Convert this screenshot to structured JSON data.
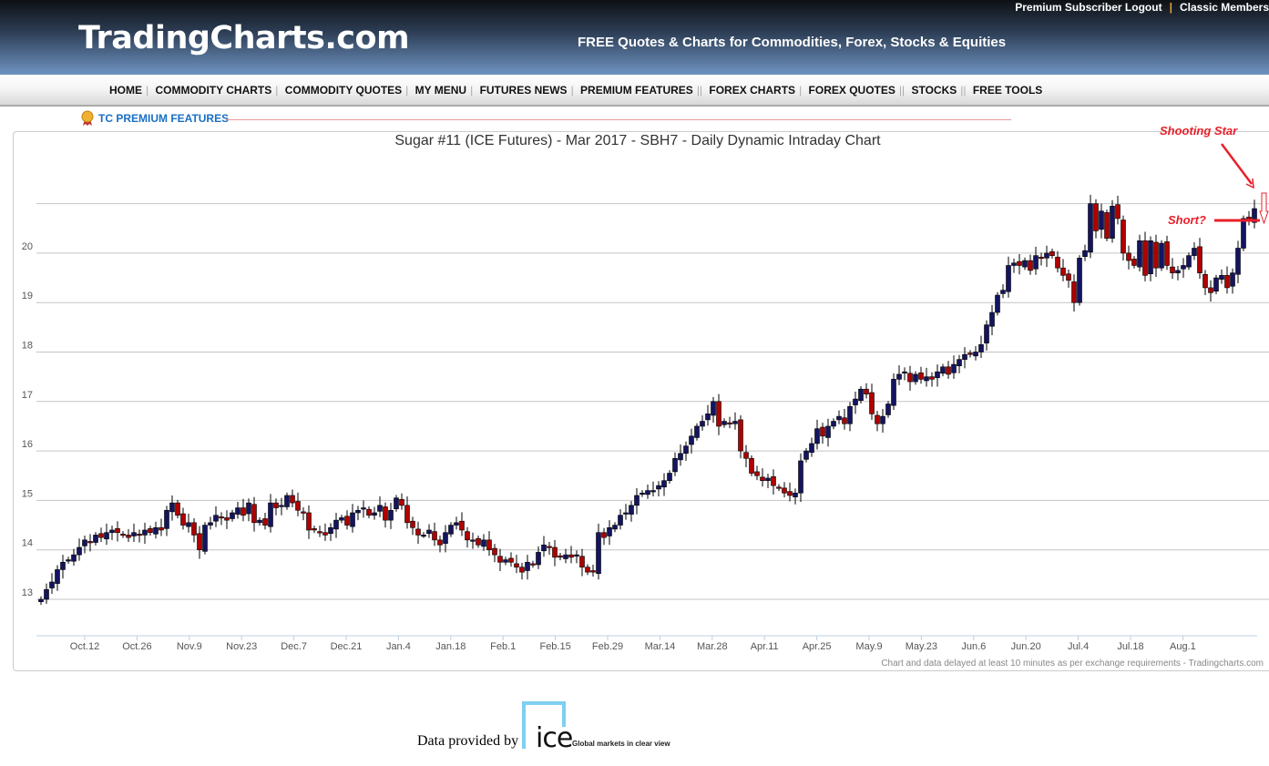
{
  "header": {
    "logo": "TradingCharts.com",
    "tagline": "FREE Quotes & Charts for Commodities, Forex, Stocks & Equities",
    "links": [
      "Premium Subscriber Logout",
      "Classic Members"
    ]
  },
  "nav": [
    "HOME",
    "COMMODITY CHARTS",
    "COMMODITY QUOTES",
    "MY MENU",
    "FUTURES NEWS",
    "PREMIUM FEATURES",
    "FOREX CHARTS",
    "FOREX QUOTES",
    "STOCKS",
    "FREE TOOLS"
  ],
  "section": {
    "title": "TC PREMIUM FEATURES",
    "icon": "award-ribbon-icon"
  },
  "footer": {
    "delay_note": "Chart and data delayed at least 10 minutes as per exchange requirements - Tradingcharts.com",
    "provided_by": "Data provided by",
    "provider_logo": "ice",
    "provider_tagline": "Global markets in clear view"
  },
  "chart_data": {
    "type": "candlestick",
    "title": "Sugar #11 (ICE Futures) - Mar 2017 - SBH7 - Daily Dynamic Intraday Chart",
    "ylim": [
      12.4,
      21.6
    ],
    "yticks": [
      13,
      14,
      15,
      16,
      17,
      18,
      19,
      20
    ],
    "grid": true,
    "xticks": [
      "Oct.12",
      "Oct.26",
      "Nov.9",
      "Nov.23",
      "Dec.7",
      "Dec.21",
      "Jan.4",
      "Jan.18",
      "Feb.1",
      "Feb.15",
      "Feb.29",
      "Mar.14",
      "Mar.28",
      "Apr.11",
      "Apr.25",
      "May.9",
      "May.23",
      "Jun.6",
      "Jun.20",
      "Jul.4",
      "Jul.18",
      "Aug.1"
    ],
    "colors": {
      "up": "#141460",
      "down": "#b00000",
      "annotation": "#e8202a"
    },
    "closes": [
      13.0,
      13.2,
      13.35,
      13.6,
      13.75,
      13.8,
      13.9,
      14.05,
      14.2,
      14.15,
      14.3,
      14.25,
      14.35,
      14.4,
      14.35,
      14.3,
      14.25,
      14.35,
      14.3,
      14.4,
      14.35,
      14.45,
      14.4,
      14.8,
      14.95,
      14.7,
      14.5,
      14.55,
      14.3,
      14.0,
      14.5,
      14.55,
      14.7,
      14.65,
      14.6,
      14.75,
      14.85,
      14.7,
      14.95,
      14.55,
      14.6,
      14.5,
      14.95,
      14.85,
      14.9,
      15.1,
      14.95,
      14.8,
      14.75,
      14.4,
      14.4,
      14.35,
      14.3,
      14.45,
      14.6,
      14.65,
      14.5,
      14.75,
      14.8,
      14.85,
      14.7,
      14.75,
      14.9,
      14.6,
      14.8,
      15.05,
      14.9,
      14.55,
      14.45,
      14.3,
      14.3,
      14.4,
      14.2,
      14.1,
      14.35,
      14.5,
      14.55,
      14.4,
      14.2,
      14.2,
      14.1,
      14.2,
      14.0,
      13.9,
      13.75,
      13.8,
      13.75,
      13.65,
      13.55,
      13.75,
      13.7,
      13.95,
      14.1,
      14.05,
      13.85,
      13.85,
      13.9,
      13.85,
      13.9,
      13.65,
      13.55,
      13.55,
      14.35,
      14.25,
      14.45,
      14.5,
      14.7,
      14.75,
      14.9,
      15.1,
      15.15,
      15.2,
      15.2,
      15.3,
      15.4,
      15.55,
      15.85,
      15.95,
      16.1,
      16.3,
      16.5,
      16.6,
      16.75,
      17.0,
      16.5,
      16.6,
      16.55,
      16.6,
      16.0,
      15.85,
      15.55,
      15.5,
      15.4,
      15.45,
      15.3,
      15.25,
      15.15,
      15.1,
      15.15,
      15.8,
      16.0,
      16.15,
      16.45,
      16.3,
      16.5,
      16.6,
      16.7,
      16.55,
      16.9,
      17.05,
      17.25,
      17.15,
      16.75,
      16.55,
      16.7,
      16.95,
      17.45,
      17.55,
      17.6,
      17.4,
      17.55,
      17.45,
      17.5,
      17.45,
      17.6,
      17.7,
      17.55,
      17.75,
      17.85,
      17.95,
      17.95,
      18.0,
      18.15,
      18.55,
      18.8,
      19.15,
      19.25,
      19.75,
      19.8,
      19.75,
      19.85,
      19.65,
      19.95,
      19.9,
      20.0,
      19.95,
      19.7,
      19.55,
      19.45,
      19.0,
      19.9,
      20.05,
      21.0,
      20.45,
      20.85,
      20.3,
      20.95,
      20.7,
      20.0,
      19.85,
      19.75,
      20.25,
      19.55,
      20.25,
      19.7,
      20.2,
      19.75,
      19.6,
      19.65,
      19.75,
      19.95,
      20.1,
      19.6,
      19.3,
      19.2,
      19.5,
      19.55,
      19.3,
      19.6,
      20.1,
      20.7,
      20.65,
      20.9
    ],
    "annotations": [
      {
        "text": "Shooting Star",
        "type": "arrow"
      },
      {
        "text": "Short?",
        "type": "level-line",
        "price": 20.7
      }
    ]
  }
}
